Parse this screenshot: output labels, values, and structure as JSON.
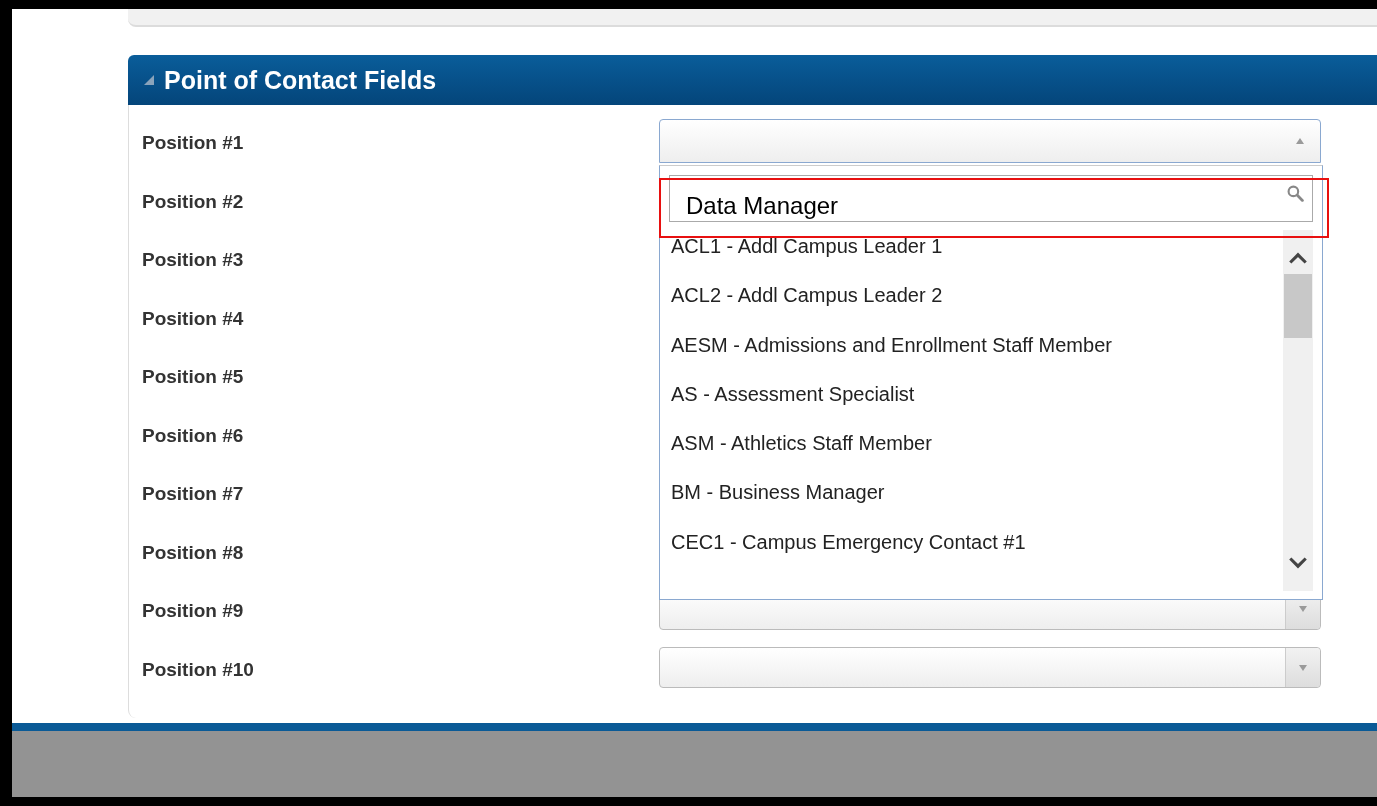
{
  "panel": {
    "title": "Point of Contact Fields",
    "expanded": true
  },
  "positions": [
    {
      "label": "Position #1",
      "kind": "open"
    },
    {
      "label": "Position #2",
      "kind": "covered"
    },
    {
      "label": "Position #3",
      "kind": "covered"
    },
    {
      "label": "Position #4",
      "kind": "covered"
    },
    {
      "label": "Position #5",
      "kind": "covered"
    },
    {
      "label": "Position #6",
      "kind": "covered"
    },
    {
      "label": "Position #7",
      "kind": "covered"
    },
    {
      "label": "Position #8",
      "kind": "covered"
    },
    {
      "label": "Position #9",
      "kind": "closed"
    },
    {
      "label": "Position #10",
      "kind": "closed"
    }
  ],
  "dropdown": {
    "search_value": "Data Manager",
    "highlighted": true,
    "options": [
      "ACL1 - Addl Campus Leader 1",
      "ACL2 - Addl Campus Leader 2",
      "AESM - Admissions and Enrollment Staff Member",
      "AS - Assessment Specialist",
      "ASM - Athletics Staff Member",
      "BM - Business Manager",
      "CEC1 - Campus Emergency Contact #1"
    ]
  }
}
